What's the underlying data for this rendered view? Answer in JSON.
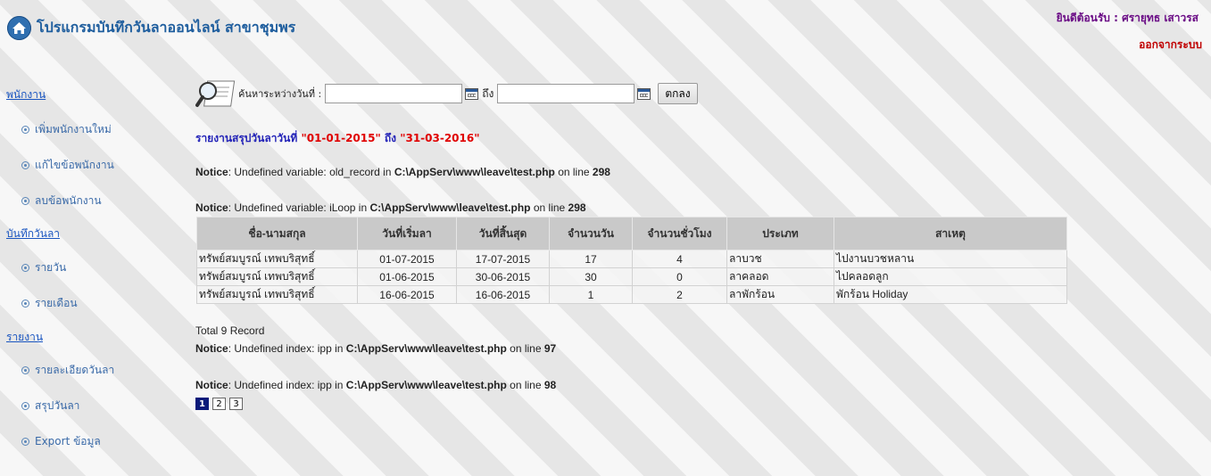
{
  "header": {
    "title": "โปรแกรมบันทึกวันลาออนไลน์ สาขาชุมพร",
    "welcome": "ยินดีต้อนรับ : ศรายุทธ เสาวรส",
    "logout": "ออกจากระบบ"
  },
  "sidebar": {
    "sections": [
      {
        "label": "พนักงาน",
        "items": [
          "เพิ่มพนักงานใหม่",
          "แก้ไขข้อพนักงาน",
          "ลบข้อพนักงาน"
        ]
      },
      {
        "label": "บันทึกวันลา",
        "items": [
          "รายวัน",
          "รายเดือน"
        ]
      },
      {
        "label": "รายงาน",
        "items": [
          "รายละเอียดวันลา",
          "สรุปวันลา",
          "Export ข้อมูล"
        ]
      }
    ]
  },
  "search": {
    "label": "ค้นหาระหว่างวันที่ :",
    "from_value": "",
    "to_label": "ถึง",
    "to_value": "",
    "submit": "ตกลง"
  },
  "report": {
    "prefix": "รายงานสรุปวันลาวันที่ ",
    "start": "\"01-01-2015\"",
    "middle": " ถึง ",
    "end": "\"31-03-2016\""
  },
  "notices": [
    {
      "label": "Notice",
      "text1": ": Undefined variable: old_record in ",
      "path": "C:\\AppServ\\www\\leave\\test.php",
      "text2": " on line ",
      "line": "298"
    },
    {
      "label": "Notice",
      "text1": ": Undefined variable: iLoop in ",
      "path": "C:\\AppServ\\www\\leave\\test.php",
      "text2": " on line ",
      "line": "298"
    },
    {
      "label": "Notice",
      "text1": ": Undefined index: ipp in ",
      "path": "C:\\AppServ\\www\\leave\\test.php",
      "text2": " on line ",
      "line": "97"
    },
    {
      "label": "Notice",
      "text1": ": Undefined index: ipp in ",
      "path": "C:\\AppServ\\www\\leave\\test.php",
      "text2": " on line ",
      "line": "98"
    }
  ],
  "table": {
    "headers": [
      "ชื่อ-นามสกุล",
      "วันที่เริ่มลา",
      "วันที่สิ้นสุด",
      "จำนวนวัน",
      "จำนวนชั่วโมง",
      "ประเภท",
      "สาเหตุ"
    ],
    "rows": [
      [
        "ทรัพย์สมบูรณ์ เทพบริสุทธิ์",
        "01-07-2015",
        "17-07-2015",
        "17",
        "4",
        "ลาบวช",
        "ไปงานบวชหลาน"
      ],
      [
        "ทรัพย์สมบูรณ์ เทพบริสุทธิ์",
        "01-06-2015",
        "30-06-2015",
        "30",
        "0",
        "ลาคลอด",
        "ไปคลอดลูก"
      ],
      [
        "ทรัพย์สมบูรณ์ เทพบริสุทธิ์",
        "16-06-2015",
        "16-06-2015",
        "1",
        "2",
        "ลาพักร้อน",
        "พักร้อน Holiday"
      ]
    ]
  },
  "total": "Total 9 Record",
  "pagination": {
    "pages": [
      "1",
      "2",
      "3"
    ],
    "current": "1"
  },
  "colors": {
    "title": "#1f5e9e",
    "welcome": "#6a0b85",
    "logout": "#c00000",
    "report_date": "#e00000",
    "report_text": "#2424b8",
    "page_active": "#0a1a7a"
  }
}
